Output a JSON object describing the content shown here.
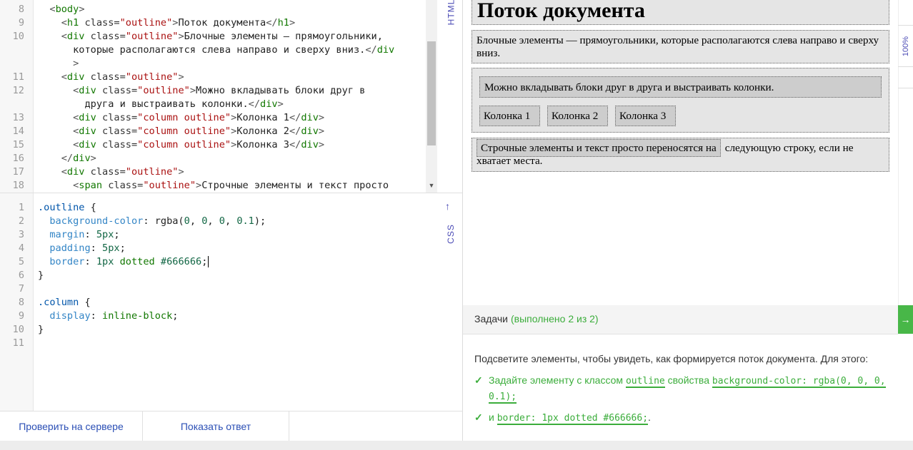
{
  "html_editor": {
    "label": "HTML",
    "lines": [
      {
        "n": "8",
        "parts": [
          [
            "t-ang",
            "  <"
          ],
          [
            "t-tag",
            "body"
          ],
          [
            "t-ang",
            ">"
          ]
        ]
      },
      {
        "n": "9",
        "parts": [
          [
            "t-ang",
            "    <"
          ],
          [
            "t-tag",
            "h1"
          ],
          [
            "t-attr",
            " class="
          ],
          [
            "t-str",
            "\"outline\""
          ],
          [
            "t-ang",
            ">"
          ],
          [
            "t-plain",
            "Поток документа"
          ],
          [
            "t-ang",
            "</"
          ],
          [
            "t-tag",
            "h1"
          ],
          [
            "t-ang",
            ">"
          ]
        ]
      },
      {
        "n": "10",
        "parts": [
          [
            "t-ang",
            "    <"
          ],
          [
            "t-tag",
            "div"
          ],
          [
            "t-attr",
            " class="
          ],
          [
            "t-str",
            "\"outline\""
          ],
          [
            "t-ang",
            ">"
          ],
          [
            "t-plain",
            "Блочные элементы — прямоугольники,"
          ]
        ]
      },
      {
        "n": "",
        "parts": [
          [
            "t-plain",
            "      которые располагаются слева направо и сверху вниз."
          ],
          [
            "t-ang",
            "</"
          ],
          [
            "t-tag",
            "div"
          ]
        ]
      },
      {
        "n": "",
        "parts": [
          [
            "t-ang",
            "      >"
          ]
        ]
      },
      {
        "n": "11",
        "parts": [
          [
            "t-ang",
            "    <"
          ],
          [
            "t-tag",
            "div"
          ],
          [
            "t-attr",
            " class="
          ],
          [
            "t-str",
            "\"outline\""
          ],
          [
            "t-ang",
            ">"
          ]
        ]
      },
      {
        "n": "12",
        "parts": [
          [
            "t-ang",
            "      <"
          ],
          [
            "t-tag",
            "div"
          ],
          [
            "t-attr",
            " class="
          ],
          [
            "t-str",
            "\"outline\""
          ],
          [
            "t-ang",
            ">"
          ],
          [
            "t-plain",
            "Можно вкладывать блоки друг в"
          ]
        ]
      },
      {
        "n": "",
        "parts": [
          [
            "t-plain",
            "        друга и выстраивать колонки."
          ],
          [
            "t-ang",
            "</"
          ],
          [
            "t-tag",
            "div"
          ],
          [
            "t-ang",
            ">"
          ]
        ]
      },
      {
        "n": "13",
        "parts": [
          [
            "t-ang",
            "      <"
          ],
          [
            "t-tag",
            "div"
          ],
          [
            "t-attr",
            " class="
          ],
          [
            "t-str",
            "\"column outline\""
          ],
          [
            "t-ang",
            ">"
          ],
          [
            "t-plain",
            "Колонка 1"
          ],
          [
            "t-ang",
            "</"
          ],
          [
            "t-tag",
            "div"
          ],
          [
            "t-ang",
            ">"
          ]
        ]
      },
      {
        "n": "14",
        "parts": [
          [
            "t-ang",
            "      <"
          ],
          [
            "t-tag",
            "div"
          ],
          [
            "t-attr",
            " class="
          ],
          [
            "t-str",
            "\"column outline\""
          ],
          [
            "t-ang",
            ">"
          ],
          [
            "t-plain",
            "Колонка 2"
          ],
          [
            "t-ang",
            "</"
          ],
          [
            "t-tag",
            "div"
          ],
          [
            "t-ang",
            ">"
          ]
        ]
      },
      {
        "n": "15",
        "parts": [
          [
            "t-ang",
            "      <"
          ],
          [
            "t-tag",
            "div"
          ],
          [
            "t-attr",
            " class="
          ],
          [
            "t-str",
            "\"column outline\""
          ],
          [
            "t-ang",
            ">"
          ],
          [
            "t-plain",
            "Колонка 3"
          ],
          [
            "t-ang",
            "</"
          ],
          [
            "t-tag",
            "div"
          ],
          [
            "t-ang",
            ">"
          ]
        ]
      },
      {
        "n": "16",
        "parts": [
          [
            "t-ang",
            "    </"
          ],
          [
            "t-tag",
            "div"
          ],
          [
            "t-ang",
            ">"
          ]
        ]
      },
      {
        "n": "17",
        "parts": [
          [
            "t-ang",
            "    <"
          ],
          [
            "t-tag",
            "div"
          ],
          [
            "t-attr",
            " class="
          ],
          [
            "t-str",
            "\"outline\""
          ],
          [
            "t-ang",
            ">"
          ]
        ]
      },
      {
        "n": "18",
        "parts": [
          [
            "t-ang",
            "      <"
          ],
          [
            "t-tag",
            "span"
          ],
          [
            "t-attr",
            " class="
          ],
          [
            "t-str",
            "\"outline\""
          ],
          [
            "t-ang",
            ">"
          ],
          [
            "t-plain",
            "Строчные элементы и текст просто"
          ]
        ]
      }
    ]
  },
  "css_editor": {
    "label": "CSS",
    "up_arrow": "↑",
    "lines": [
      {
        "n": "1",
        "parts": [
          [
            "t-sel",
            ".outline"
          ],
          [
            "t-plain",
            " {"
          ]
        ]
      },
      {
        "n": "2",
        "parts": [
          [
            "t-prop",
            "  background-color"
          ],
          [
            "t-plain",
            ": rgba("
          ],
          [
            "t-num",
            "0"
          ],
          [
            "t-plain",
            ", "
          ],
          [
            "t-num",
            "0"
          ],
          [
            "t-plain",
            ", "
          ],
          [
            "t-num",
            "0"
          ],
          [
            "t-plain",
            ", "
          ],
          [
            "t-num",
            "0.1"
          ],
          [
            "t-plain",
            ");"
          ]
        ]
      },
      {
        "n": "3",
        "parts": [
          [
            "t-prop",
            "  margin"
          ],
          [
            "t-plain",
            ": "
          ],
          [
            "t-num",
            "5px"
          ],
          [
            "t-plain",
            ";"
          ]
        ]
      },
      {
        "n": "4",
        "parts": [
          [
            "t-prop",
            "  padding"
          ],
          [
            "t-plain",
            ": "
          ],
          [
            "t-num",
            "5px"
          ],
          [
            "t-plain",
            ";"
          ]
        ]
      },
      {
        "n": "5",
        "parts": [
          [
            "t-prop",
            "  border"
          ],
          [
            "t-plain",
            ": "
          ],
          [
            "t-num",
            "1px"
          ],
          [
            "t-kw",
            " dotted"
          ],
          [
            "t-num",
            " #666666"
          ],
          [
            "t-plain",
            ";"
          ]
        ],
        "cursor": true
      },
      {
        "n": "6",
        "parts": [
          [
            "t-plain",
            "}"
          ]
        ]
      },
      {
        "n": "7",
        "parts": []
      },
      {
        "n": "8",
        "parts": [
          [
            "t-sel",
            ".column"
          ],
          [
            "t-plain",
            " {"
          ]
        ]
      },
      {
        "n": "9",
        "parts": [
          [
            "t-prop",
            "  display"
          ],
          [
            "t-plain",
            ": "
          ],
          [
            "t-kw",
            "inline-block"
          ],
          [
            "t-plain",
            ";"
          ]
        ]
      },
      {
        "n": "10",
        "parts": [
          [
            "t-plain",
            "}"
          ]
        ]
      },
      {
        "n": "11",
        "parts": []
      }
    ]
  },
  "bottom_bar": {
    "check_label": "Проверить на сервере",
    "answer_label": "Показать ответ"
  },
  "preview": {
    "h1": "Поток документа",
    "block_text": "Блочные элементы — прямоугольники, которые располагаются слева направо и сверху вниз.",
    "nested_text": "Можно вкладывать блоки друг в друга и выстраивать колонки.",
    "columns": [
      "Колонка 1",
      "Колонка 2",
      "Колонка 3"
    ],
    "inline_span": "Строчные элементы и текст просто переносятся на",
    "inline_rest": "следующую строку, если не хватает места."
  },
  "side_scroll": {
    "zoom_label": "100%"
  },
  "tasks": {
    "title": "Задачи",
    "progress": "(выполнено 2 из 2)",
    "intro": "Подсветите элементы, чтобы увидеть, как формируется поток документа. Для этого:",
    "task1_a": "Задайте элементу с классом",
    "task1_code1": "outline",
    "task1_b": "свойства",
    "task1_code2": "background-color: rgba(0, 0, 0,",
    "task1_code3": "0.1);",
    "task2_a": "и",
    "task2_code": "border: 1px dotted #666666;",
    "task2_end": "."
  },
  "colors": {
    "accent_green": "#3bad3b",
    "link_blue": "#2b4fb5"
  }
}
